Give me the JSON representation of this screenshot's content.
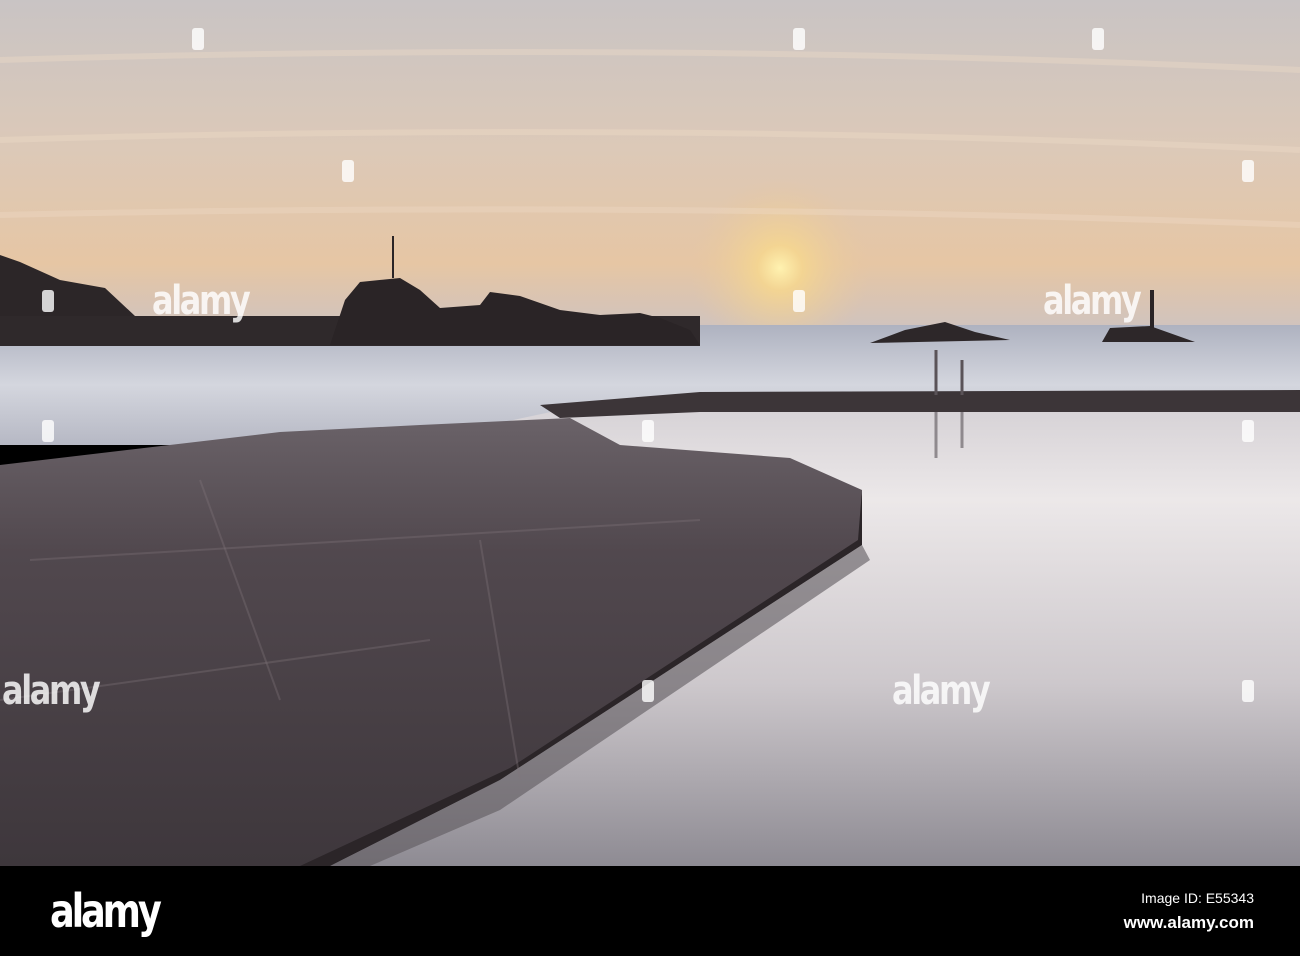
{
  "photo": {
    "subject": "Tidal sea pool at sunset",
    "colors": {
      "sky_top": "#c8c3c3",
      "sky_glow": "#e9c6a0",
      "sun": "#fff0b0",
      "sea": "#c3c6d0",
      "pool_light": "#ebe7e8",
      "pool_dark": "#8f8c94",
      "concrete": "#4b4349",
      "rock": "#2c2628"
    }
  },
  "watermark": {
    "text": "alamy"
  },
  "footer": {
    "logo": "alamy",
    "image_id": "Image ID: E55343",
    "url": "www.alamy.com"
  }
}
